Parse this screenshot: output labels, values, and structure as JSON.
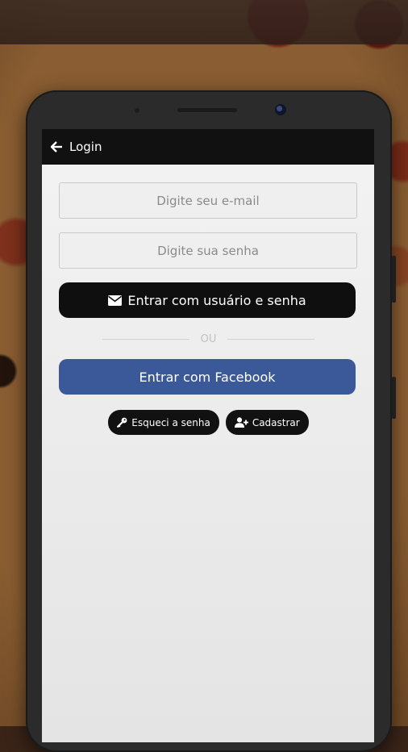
{
  "appbar": {
    "title": "Login",
    "back_icon": "arrow-left-icon"
  },
  "form": {
    "email_placeholder": "Digite seu e-mail",
    "email_value": "",
    "password_placeholder": "Digite sua senha",
    "password_value": "",
    "login_button_label": "Entrar com usuário e senha",
    "login_button_icon": "envelope-icon",
    "divider_text": "OU",
    "facebook_button_label": "Entrar com Facebook",
    "forgot_button_label": "Esqueci a senha",
    "forgot_button_icon": "key-icon",
    "register_button_label": "Cadastrar",
    "register_button_icon": "user-plus-icon"
  },
  "colors": {
    "appbar_bg": "#111111",
    "dark_button": "#0f0f0f",
    "facebook_blue": "#3b5998",
    "screen_bg": "#efefef"
  }
}
